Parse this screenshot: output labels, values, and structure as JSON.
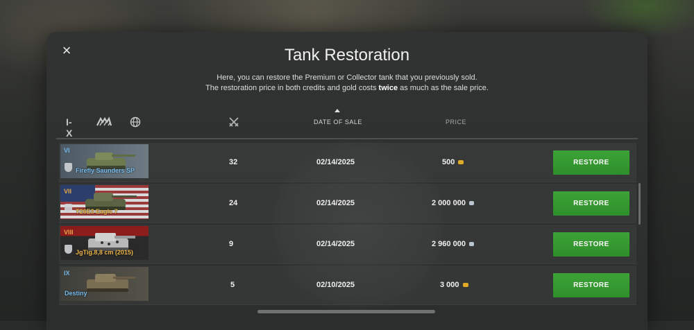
{
  "modal": {
    "title": "Tank Restoration",
    "description_line1": "Here, you can restore the Premium or Collector tank that you previously sold.",
    "description_line2_prefix": "The restoration price in both credits and gold costs ",
    "description_line2_bold": "twice",
    "description_line2_suffix": " as much as the sale price.",
    "close_icon": "×"
  },
  "filters": {
    "tier_label": "I-X",
    "class_icon": "tank-class-icon",
    "nation_icon": "globe-icon"
  },
  "columns": {
    "battles_icon": "crossed-swords-icon",
    "date_of_sale": "DATE OF SALE",
    "price": "PRICE",
    "sort_icon": "sort-ascending-icon"
  },
  "currency_icons": {
    "gold": "#e0a927",
    "credits": "#b9c6cf"
  },
  "rows": [
    {
      "tier": "VI",
      "tier_color": "#6fb3e6",
      "name": "Firefly Saunders SP",
      "name_color": "#7cc0ef",
      "battles": "32",
      "date": "02/14/2025",
      "price": "500",
      "currency": "gold",
      "restore_label": "RESTORE"
    },
    {
      "tier": "VII",
      "tier_color": "#e6a64a",
      "name": "T26E3 Eagle 7",
      "name_color": "#f0b848",
      "battles": "24",
      "date": "02/14/2025",
      "price": "2 000 000",
      "currency": "credits",
      "restore_label": "RESTORE"
    },
    {
      "tier": "VIII",
      "tier_color": "#e6a64a",
      "name": "JgTig.8,8 cm (2015)",
      "name_color": "#f0b848",
      "battles": "9",
      "date": "02/14/2025",
      "price": "2 960 000",
      "currency": "credits",
      "restore_label": "RESTORE"
    },
    {
      "tier": "IX",
      "tier_color": "#6fb3e6",
      "name": "Destiny",
      "name_color": "#7cc0ef",
      "battles": "5",
      "date": "02/10/2025",
      "price": "3 000",
      "currency": "gold",
      "restore_label": "RESTORE"
    }
  ]
}
